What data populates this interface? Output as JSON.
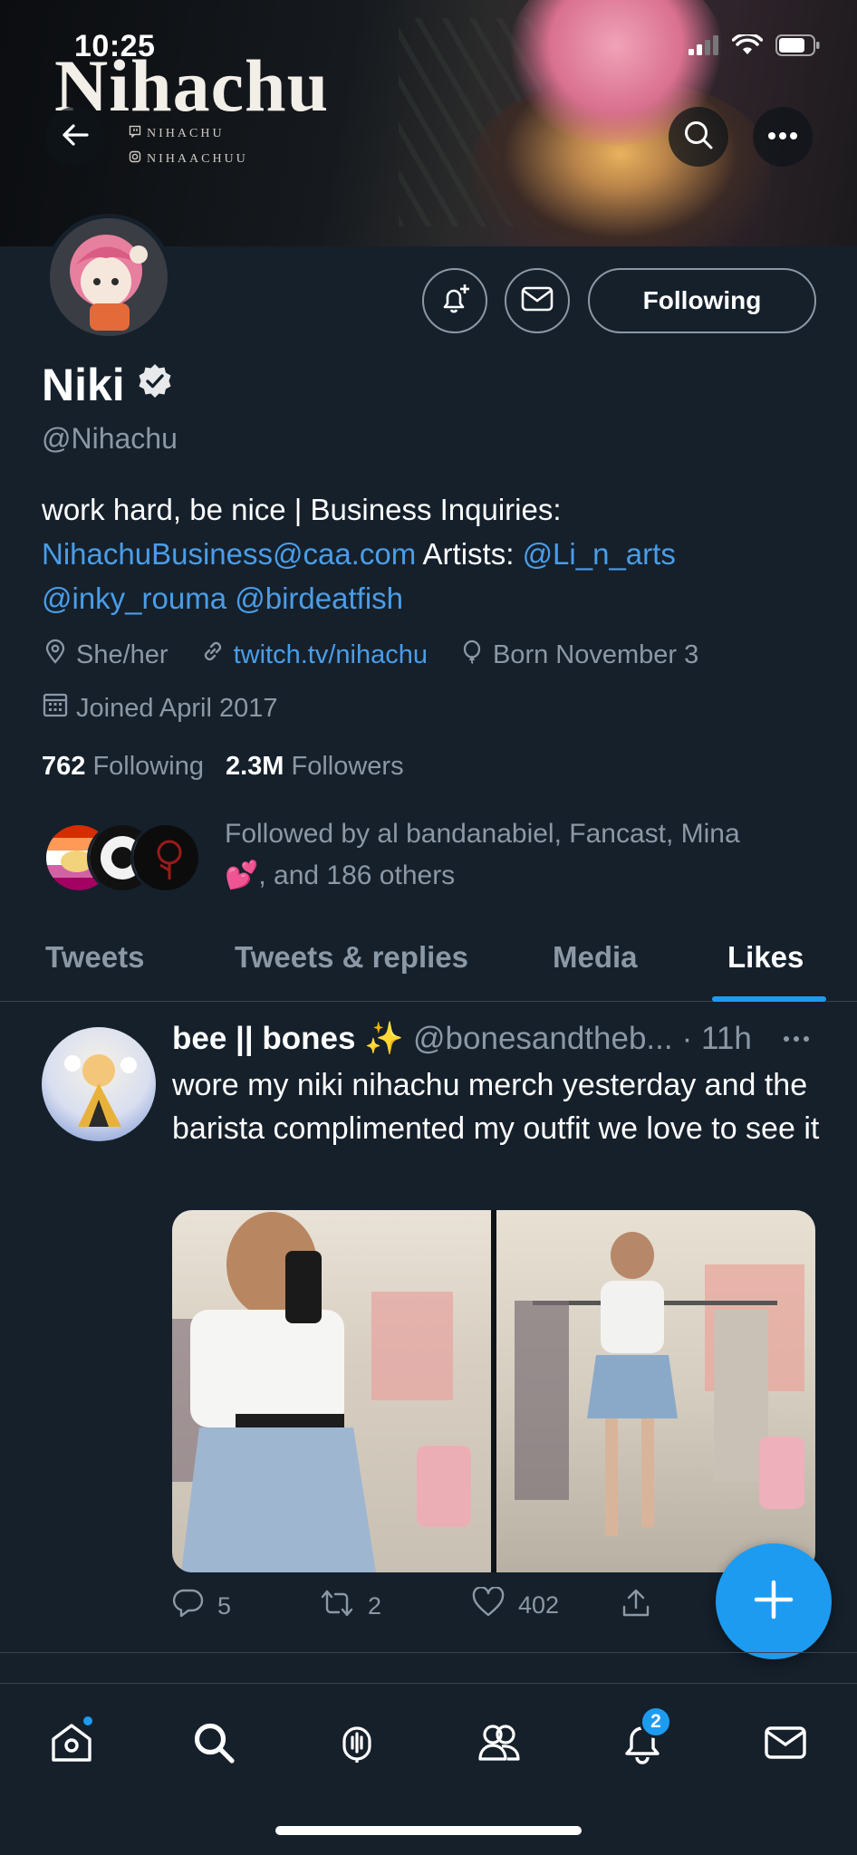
{
  "status_bar": {
    "time": "10:25"
  },
  "banner": {
    "title": "Nihachu",
    "line1": "NIHACHU",
    "line2": "NIHAACHUU"
  },
  "profile": {
    "follow_button": "Following",
    "name": "Niki",
    "handle": "@Nihachu",
    "bio_text_1": "work hard, be nice | Business Inquiries:",
    "bio_email": "NihachuBusiness@caa.com",
    "bio_text_2": " Artists: ",
    "bio_artist_1": "@Li_n_arts",
    "bio_artist_2": "@inky_rouma",
    "bio_artist_3": "@birdeatfish",
    "pronouns": "She/her",
    "website": "twitch.tv/nihachu",
    "born": "Born November 3",
    "joined": "Joined April 2017",
    "following_count": "762",
    "following_label": "Following",
    "followers_count": "2.3M",
    "followers_label": "Followers",
    "followed_by_line1": "Followed by al bandanabiel, Fancast, Mina",
    "followed_by_emoji": "💕",
    "followed_by_line2": ", and 186 others"
  },
  "tabs": [
    "Tweets",
    "Tweets & replies",
    "Media",
    "Likes"
  ],
  "active_tab": "Likes",
  "tweet": {
    "author": "bee || bones",
    "author_emoji": "✨",
    "handle": "@bonesandtheb...",
    "time": "· 11h",
    "text": "wore my niki nihachu merch yesterday and the barista complimented my outfit we love to see it",
    "replies": "5",
    "retweets": "2",
    "likes": "402"
  },
  "bottom_nav": {
    "notifications_badge": "2"
  },
  "colors": {
    "background": "#15202b",
    "accent": "#1d9bf0",
    "link": "#4a9de8",
    "muted": "#8b98a5"
  }
}
